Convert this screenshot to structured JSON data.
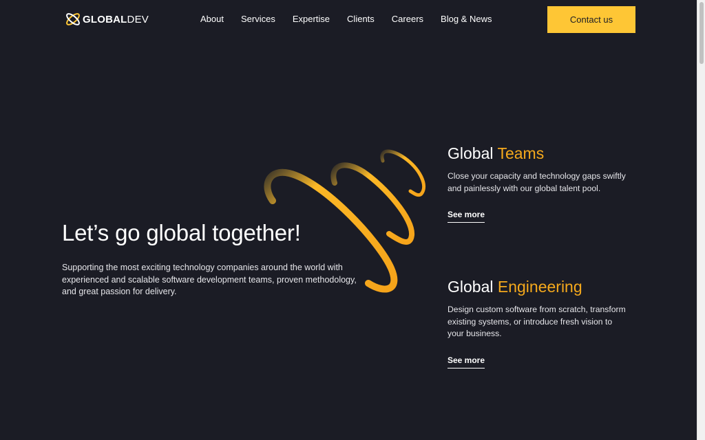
{
  "brand": {
    "name_bold": "GLOBAL",
    "name_light": "DEV",
    "accent_color": "#fec635",
    "highlight_color": "#f5a91c",
    "background_color": "#1b1c25"
  },
  "nav": {
    "items": [
      {
        "label": "About"
      },
      {
        "label": "Services"
      },
      {
        "label": "Expertise"
      },
      {
        "label": "Clients"
      },
      {
        "label": "Careers"
      },
      {
        "label": "Blog & News"
      }
    ],
    "cta_label": "Contact us"
  },
  "hero": {
    "title": "Let’s go global together!",
    "subtitle": "Supporting the most exciting technology companies around the world with experienced and scalable software development teams, proven methodology, and great passion for delivery."
  },
  "features": [
    {
      "title_prefix": "Global",
      "title_accent": "Teams",
      "description": "Close your capacity and technology gaps swiftly and painlessly with our global talent pool.",
      "link_label": "See more"
    },
    {
      "title_prefix": "Global",
      "title_accent": "Engineering",
      "description": "Design custom software from scratch, transform existing systems, or introduce fresh vision to your business.",
      "link_label": "See more"
    }
  ],
  "icons": {
    "logo": "globe-orbit-logo-icon",
    "decoration": "orbit-rings-icon"
  }
}
